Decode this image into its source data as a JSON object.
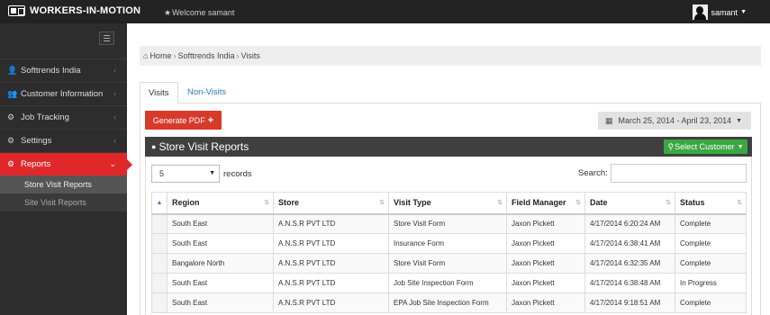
{
  "app": {
    "brand": "WORKERS-IN-MOTION",
    "welcome": "Welcome samant",
    "user": "samant"
  },
  "sidebar": {
    "items": [
      {
        "label": "Softtrends India",
        "icon": "user-icon"
      },
      {
        "label": "Customer Information",
        "icon": "users-icon"
      },
      {
        "label": "Job Tracking",
        "icon": "gears-icon"
      },
      {
        "label": "Settings",
        "icon": "gears-icon"
      },
      {
        "label": "Reports",
        "icon": "gears-icon"
      }
    ],
    "sub_items": [
      "Store Visit Reports",
      "Site Visit Reports"
    ]
  },
  "breadcrumb": {
    "home": "Home",
    "company": "Softtrends India",
    "page": "Visits"
  },
  "tabs": [
    {
      "label": "Visits"
    },
    {
      "label": "Non-Visits"
    }
  ],
  "toolbar": {
    "pdf_label": "Generate PDF",
    "date_range": "March 25, 2014 - April 23, 2014"
  },
  "panel": {
    "title": "Store Visit Reports",
    "customer_button": "Select Customer"
  },
  "table_controls": {
    "length_value": "5",
    "length_suffix": "records",
    "search_label": "Search:"
  },
  "table": {
    "headers": [
      "Region",
      "Store",
      "Visit Type",
      "Field Manager",
      "Date",
      "Status"
    ],
    "rows": [
      [
        "South East",
        "A.N.S.R PVT LTD",
        "Store Visit Form",
        "Jaxon  Pickett",
        "4/17/2014 6:20:24 AM",
        "Complete"
      ],
      [
        "South East",
        "A.N.S.R PVT LTD",
        "Insurance Form",
        "Jaxon  Pickett",
        "4/17/2014 6:38:41 AM",
        "Complete"
      ],
      [
        "Bangalore North",
        "A.N.S.R PVT LTD",
        "Store Visit Form",
        "Jaxon  Pickett",
        "4/17/2014 6:32:35 AM",
        "Complete"
      ],
      [
        "South East",
        "A.N.S.R PVT LTD",
        "Job Site Inspection Form",
        "Jaxon  Pickett",
        "4/17/2014 6:38:48 AM",
        "In Progress"
      ],
      [
        "South East",
        "A.N.S.R PVT LTD",
        "EPA Job Site Inspection Form",
        "Jaxon  Pickett",
        "4/17/2014 9:18:51 AM",
        "Complete"
      ]
    ]
  },
  "colors": {
    "accent_red": "#e0282b",
    "pdf_button": "#d73a2a",
    "customer_button": "#3aa842",
    "topbar": "#232323",
    "sidebar": "#2d2d2d"
  }
}
